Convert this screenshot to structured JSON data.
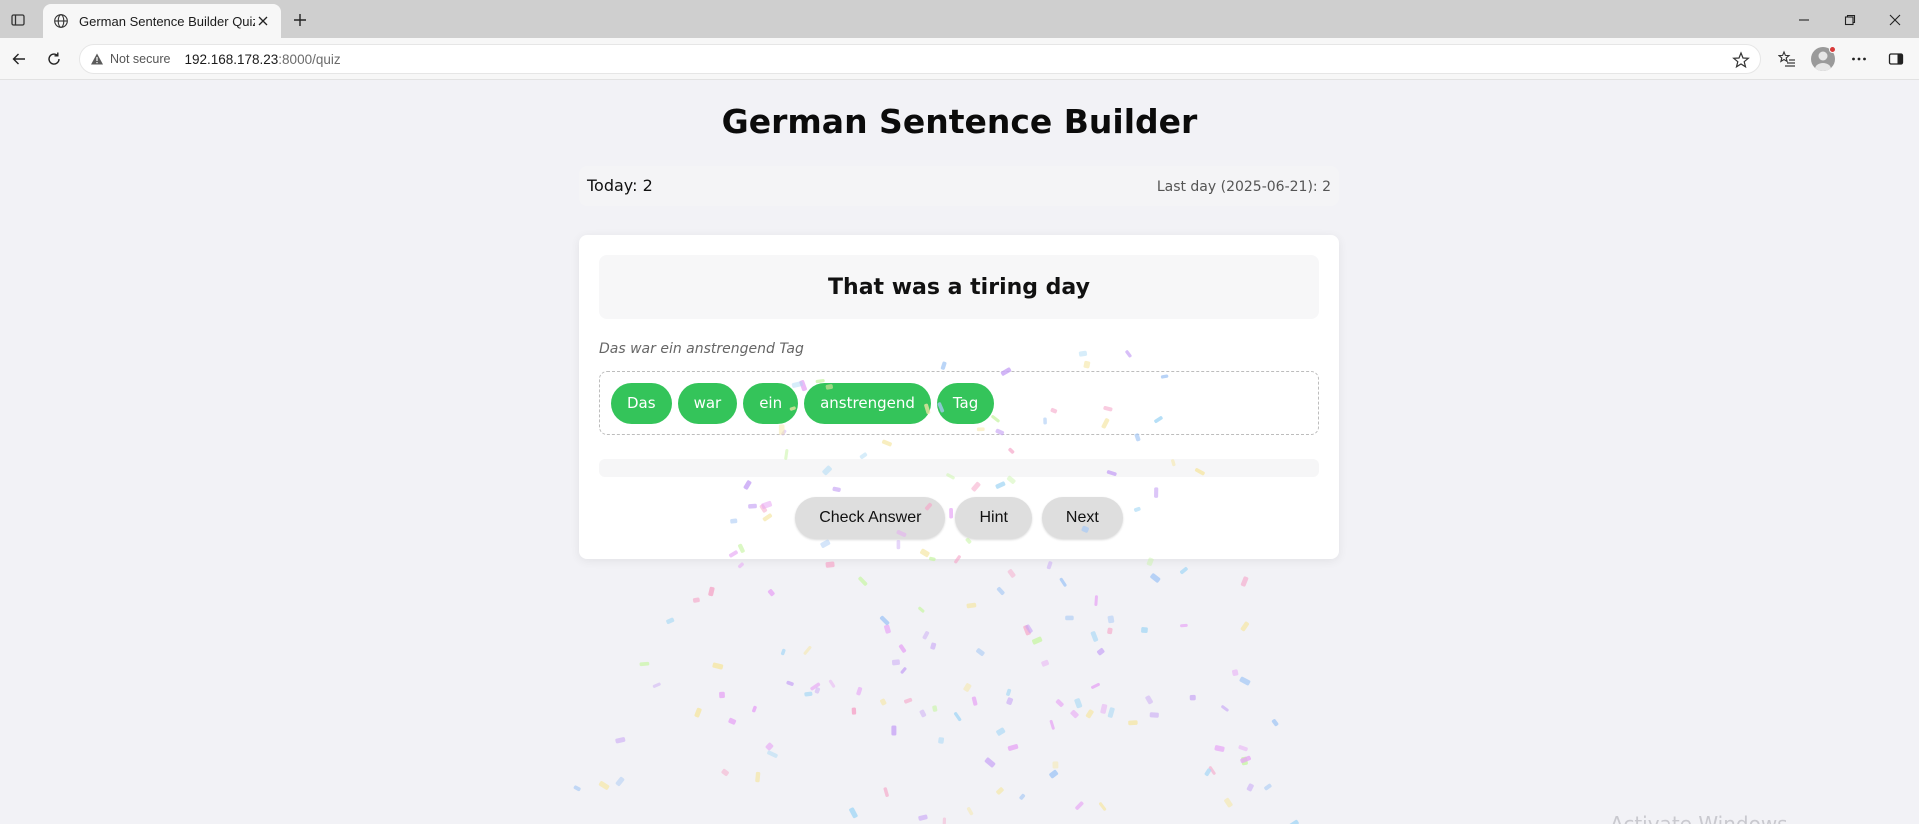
{
  "browser": {
    "tab_title": "German Sentence Builder Quiz",
    "security_label": "Not secure",
    "url_host": "192.168.178.23",
    "url_path": ":8000/quiz"
  },
  "page": {
    "title": "German Sentence Builder",
    "stats": {
      "today": "Today: 2",
      "last_day": "Last day (2025-06-21): 2"
    },
    "quiz": {
      "prompt": "That was a tiring day",
      "translation_hint": "Das war ein anstrengend Tag",
      "answer_words": [
        "Das",
        "war",
        "ein",
        "anstrengend",
        "Tag"
      ],
      "word_color": "#34c45a",
      "buttons": {
        "check": "Check Answer",
        "hint": "Hint",
        "next": "Next"
      }
    },
    "watermark": "Activate Windows"
  }
}
